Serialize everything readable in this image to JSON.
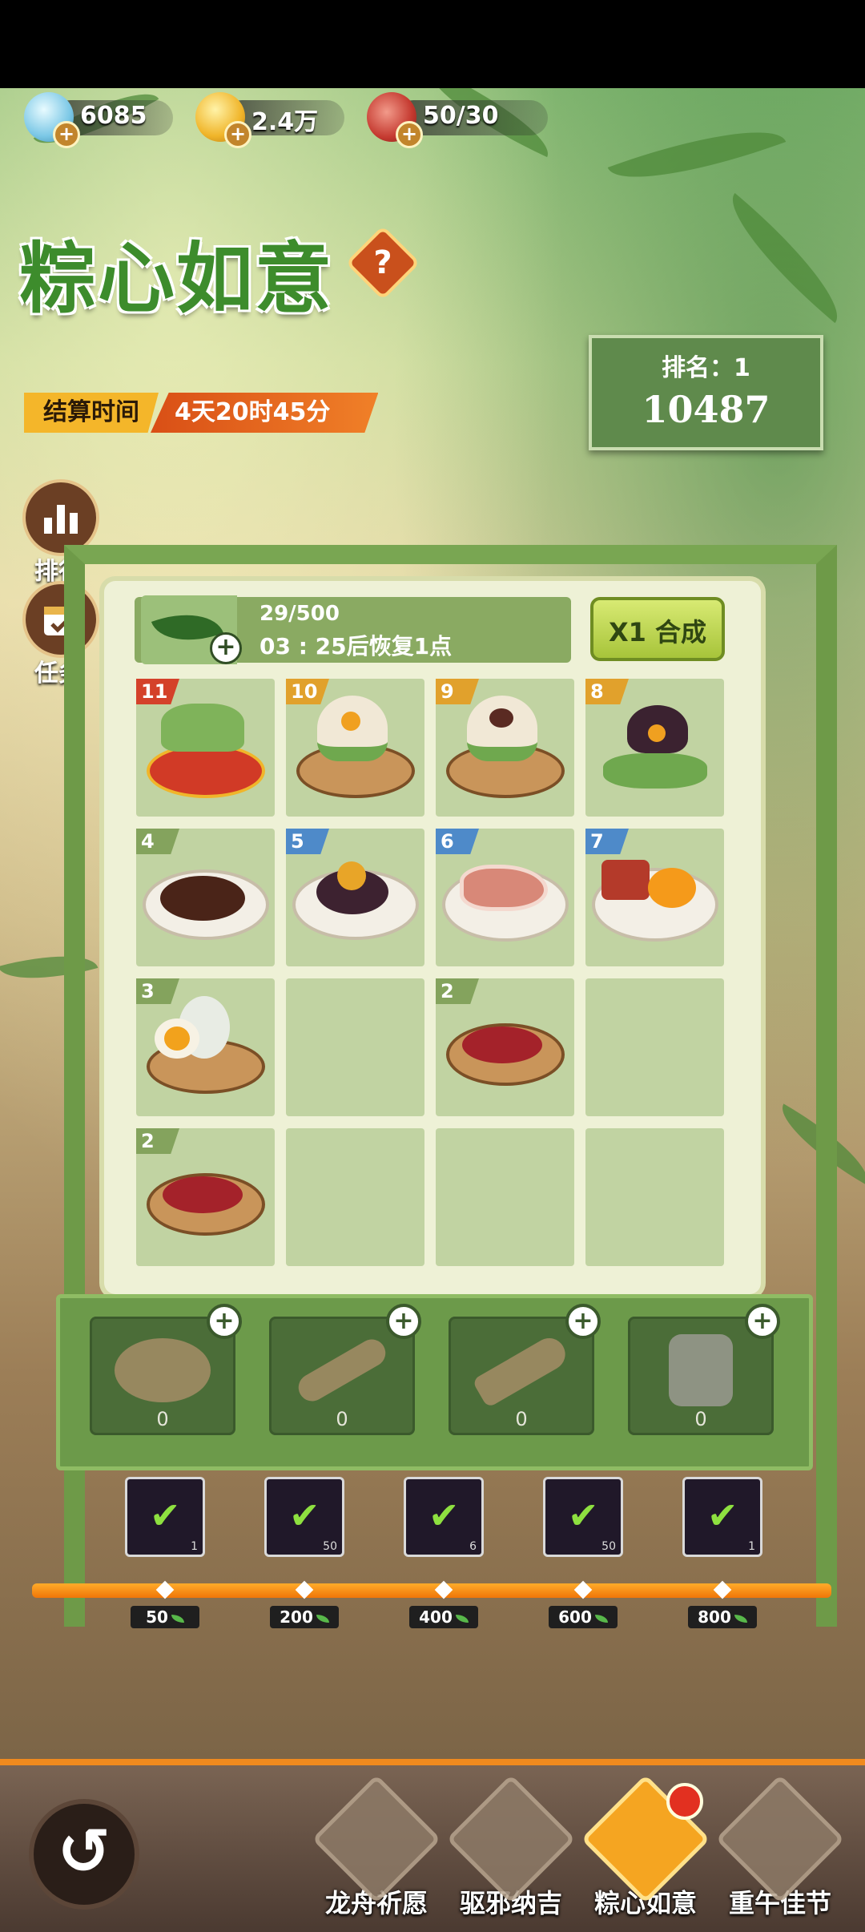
{
  "resources": [
    {
      "icon": "diamond-icon",
      "value": "6085"
    },
    {
      "icon": "gold-coin-icon",
      "value": "2.4万"
    },
    {
      "icon": "meat-stamina-icon",
      "value": "50/30"
    }
  ],
  "event": {
    "title": "粽心如意",
    "settle_label": "结算时间",
    "settle_time": "4天20时45分",
    "help_icon": "?"
  },
  "rank": {
    "label": "排名：1",
    "score": "10487"
  },
  "side_buttons": [
    {
      "icon": "bar-chart-icon",
      "label": "排行"
    },
    {
      "icon": "calendar-task-icon",
      "label": "任务"
    }
  ],
  "energy": {
    "count": "29/500",
    "recover": "03 : 25后恢复1点"
  },
  "synth_button": "X1 合成",
  "grid": [
    {
      "level": "11",
      "item": "zongzi-bundle",
      "badge": "red"
    },
    {
      "level": "10",
      "item": "zongzi-yolk",
      "badge": "gold"
    },
    {
      "level": "9",
      "item": "zongzi-bean",
      "badge": "gold"
    },
    {
      "level": "8",
      "item": "zongzi-black-rice",
      "badge": "gold"
    },
    {
      "level": "4",
      "item": "bean-paste-cake",
      "badge": "green"
    },
    {
      "level": "5",
      "item": "chestnut-dish",
      "badge": "blue"
    },
    {
      "level": "6",
      "item": "pork-slice",
      "badge": "blue"
    },
    {
      "level": "7",
      "item": "pork-egg-plate",
      "badge": "blue"
    },
    {
      "level": "3",
      "item": "salted-egg",
      "badge": "green"
    },
    {
      "level": "",
      "item": "",
      "badge": ""
    },
    {
      "level": "2",
      "item": "red-beans",
      "badge": "green"
    },
    {
      "level": "",
      "item": "",
      "badge": ""
    },
    {
      "level": "2",
      "item": "red-beans",
      "badge": "green"
    },
    {
      "level": "",
      "item": "",
      "badge": ""
    },
    {
      "level": "",
      "item": "",
      "badge": ""
    },
    {
      "level": "",
      "item": "",
      "badge": ""
    }
  ],
  "tools": [
    {
      "icon": "steamer-icon",
      "count": "0"
    },
    {
      "icon": "ladle-icon",
      "count": "0"
    },
    {
      "icon": "spatula-icon",
      "count": "0"
    },
    {
      "icon": "jar-icon",
      "count": "0"
    }
  ],
  "rewards": [
    {
      "qty": "1",
      "milestone": "50"
    },
    {
      "qty": "50",
      "milestone": "200"
    },
    {
      "qty": "6",
      "milestone": "400"
    },
    {
      "qty": "50",
      "milestone": "600"
    },
    {
      "qty": "1",
      "milestone": "800"
    }
  ],
  "nav": [
    {
      "label": "龙舟祈愿",
      "icon": "plaque-icon",
      "active": false
    },
    {
      "label": "驱邪纳吉",
      "icon": "charm-icon",
      "active": false
    },
    {
      "label": "粽心如意",
      "icon": "zongzi-icon",
      "active": true
    },
    {
      "label": "重午佳节",
      "icon": "dragon-boat-icon",
      "active": false
    }
  ],
  "colors": {
    "accent": "#f08a1e",
    "title_green": "#3d8c2c",
    "board": "#c1d3a2"
  }
}
